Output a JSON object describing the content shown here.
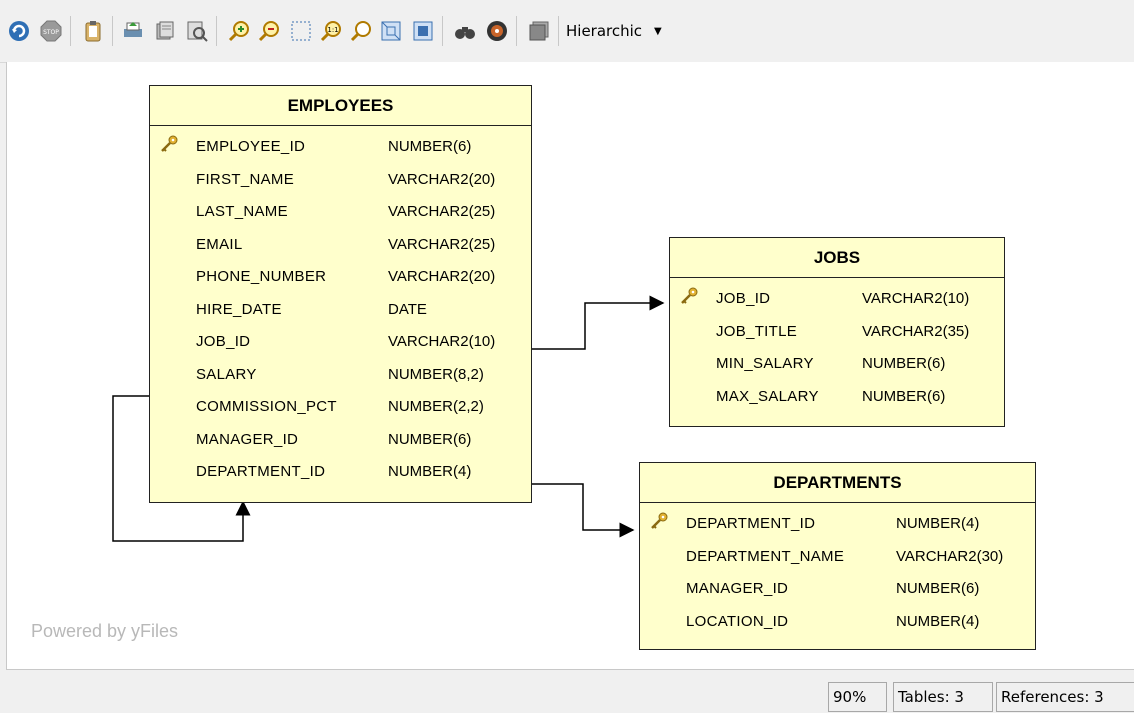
{
  "toolbar": {
    "layout_label": "Hierarchic",
    "icons": [
      "refresh-icon",
      "stop-icon",
      "clipboard-icon",
      "print-icon",
      "export-icon",
      "search-file-icon",
      "zoom-in-icon",
      "zoom-out-icon",
      "select-zoom-icon",
      "zoom-actual-icon",
      "zoom-icon",
      "fit-content-icon",
      "fit-selection-icon",
      "find-icon",
      "navigator-icon",
      "overview-icon"
    ]
  },
  "canvas": {
    "powered_by": "Powered by yFiles"
  },
  "tables": [
    {
      "name": "EMPLOYEES",
      "columns": [
        {
          "name": "EMPLOYEE_ID",
          "type": "NUMBER(6)",
          "pk": true
        },
        {
          "name": "FIRST_NAME",
          "type": "VARCHAR2(20)",
          "pk": false
        },
        {
          "name": "LAST_NAME",
          "type": "VARCHAR2(25)",
          "pk": false
        },
        {
          "name": "EMAIL",
          "type": "VARCHAR2(25)",
          "pk": false
        },
        {
          "name": "PHONE_NUMBER",
          "type": "VARCHAR2(20)",
          "pk": false
        },
        {
          "name": "HIRE_DATE",
          "type": "DATE",
          "pk": false
        },
        {
          "name": "JOB_ID",
          "type": "VARCHAR2(10)",
          "pk": false
        },
        {
          "name": "SALARY",
          "type": "NUMBER(8,2)",
          "pk": false
        },
        {
          "name": "COMMISSION_PCT",
          "type": "NUMBER(2,2)",
          "pk": false
        },
        {
          "name": "MANAGER_ID",
          "type": "NUMBER(6)",
          "pk": false
        },
        {
          "name": "DEPARTMENT_ID",
          "type": "NUMBER(4)",
          "pk": false
        }
      ]
    },
    {
      "name": "JOBS",
      "columns": [
        {
          "name": "JOB_ID",
          "type": "VARCHAR2(10)",
          "pk": true
        },
        {
          "name": "JOB_TITLE",
          "type": "VARCHAR2(35)",
          "pk": false
        },
        {
          "name": "MIN_SALARY",
          "type": "NUMBER(6)",
          "pk": false
        },
        {
          "name": "MAX_SALARY",
          "type": "NUMBER(6)",
          "pk": false
        }
      ]
    },
    {
      "name": "DEPARTMENTS",
      "columns": [
        {
          "name": "DEPARTMENT_ID",
          "type": "NUMBER(4)",
          "pk": true
        },
        {
          "name": "DEPARTMENT_NAME",
          "type": "VARCHAR2(30)",
          "pk": false
        },
        {
          "name": "MANAGER_ID",
          "type": "NUMBER(6)",
          "pk": false
        },
        {
          "name": "LOCATION_ID",
          "type": "NUMBER(4)",
          "pk": false
        }
      ]
    }
  ],
  "statusbar": {
    "zoom": "90%",
    "tables": "Tables: 3",
    "references": "References: 3"
  }
}
